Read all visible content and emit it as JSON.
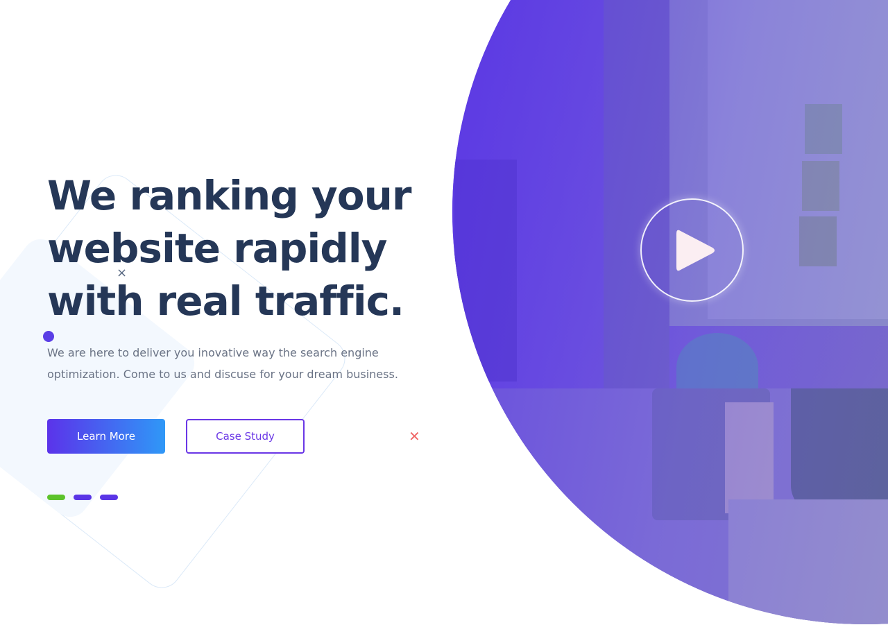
{
  "hero": {
    "title_lines": [
      "We ranking your",
      "website rapidly",
      "with real traffic."
    ],
    "description_lines": [
      "We are here to deliver you inovative way the search engine",
      "optimization. Come to us and discuse for your dream business."
    ],
    "primary_button": "Learn More",
    "secondary_button": "Case Study"
  },
  "media": {
    "play_icon": "play-icon"
  },
  "decorations": {
    "small_x": "×",
    "red_x": "✕"
  },
  "slider": {
    "dots": [
      {
        "color": "#5cc32a",
        "active": true
      },
      {
        "color": "#5a35e6",
        "active": false
      },
      {
        "color": "#5a35e6",
        "active": false
      }
    ]
  },
  "colors": {
    "title": "#253757",
    "text": "#6a7385",
    "accent_purple": "#5b33ea",
    "accent_blue": "#2f98f7",
    "accent_red": "#f06a6a",
    "accent_green": "#5cc32a"
  }
}
